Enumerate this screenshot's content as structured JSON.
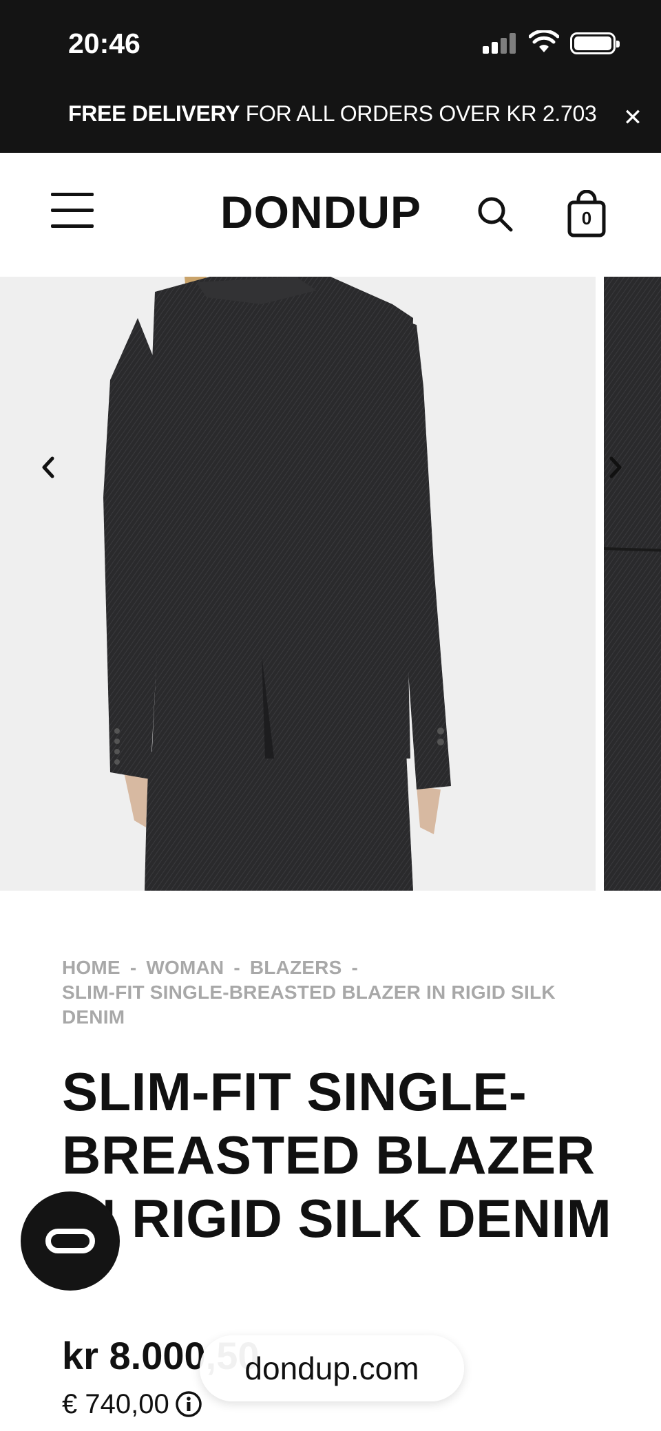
{
  "status_bar": {
    "time": "20:46"
  },
  "promo": {
    "bold": "FREE DELIVERY",
    "rest": " FOR ALL ORDERS OVER KR 2.703",
    "close_icon": "close-icon"
  },
  "header": {
    "brand": "DONDUP",
    "cart_count": "0"
  },
  "gallery": {
    "prev_icon": "chevron-left-icon",
    "next_icon": "chevron-right-icon"
  },
  "breadcrumb": {
    "items": [
      "HOME",
      "WOMAN",
      "BLAZERS",
      "SLIM-FIT SINGLE-BREASTED BLAZER IN RIGID SILK DENIM"
    ],
    "separator": "-"
  },
  "product": {
    "title": "SLIM-FIT SINGLE-BREASTED BLAZER IN RIGID SILK DENIM",
    "price": "kr 8.000,50",
    "price_eur": "€ 740,00"
  },
  "browser": {
    "url": "dondup.com"
  },
  "colors": {
    "dark_bar": "#141414",
    "breadcrumb": "#a8a8a8",
    "image_bg": "#efefef"
  }
}
